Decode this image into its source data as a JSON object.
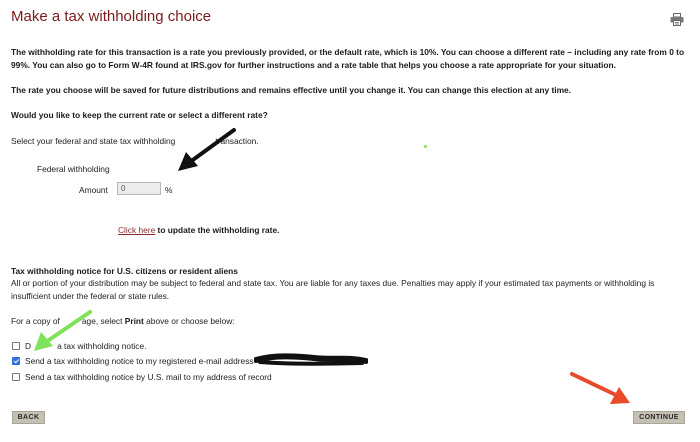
{
  "page": {
    "title": "Make a tax withholding choice",
    "icons": {
      "print": "printer-icon"
    }
  },
  "intro": {
    "p1": "The withholding rate for this transaction is a rate you previously provided, or the default rate, which is 10%. You can choose a different rate – including any rate from 0 to 99%. You can also go to Form W-4R found at IRS.gov for further instructions and a rate table that helps you choose a rate appropriate for your situation.",
    "p2": "The rate you choose will be saved for future distributions and remains effective until you change it. You can change this election at any time.",
    "question": "Would you like to keep the current rate or select a different rate?",
    "select_text": "Select your federal and state tax withholding",
    "select_text_tail": "transaction."
  },
  "federal": {
    "heading": "Federal withholding",
    "amount_label": "Amount",
    "amount_value": "0",
    "unit": "%",
    "click_link": "Click here",
    "click_tail": " to update the withholding rate."
  },
  "notice": {
    "heading": "Tax withholding notice for U.S. citizens or resident aliens",
    "body": "All or portion of your distribution may be subject to federal and state tax. You are liable for any taxes due. Penalties may apply if your estimated tax payments or withholding is insufficient under the federal or state rules.",
    "copy_pre": "For a copy of",
    "copy_mid": "age, select",
    "copy_print": "Print",
    "copy_post": "above or choose below:",
    "options": [
      {
        "label_a": "D",
        "label_b": "a tax withholding notice.",
        "checked": false
      },
      {
        "label": "Send a tax withholding notice to my registered e-mail address",
        "checked": true
      },
      {
        "label": "Send a tax withholding notice by U.S. mail to my address of record",
        "checked": false
      }
    ]
  },
  "buttons": {
    "back": "BACK",
    "continue": "CONTINUE"
  },
  "colors": {
    "title": "#7a1c1c",
    "link": "#8a2a2a",
    "button": "#c4c0b4",
    "arrow_black": "#111111",
    "arrow_green": "#7ee25a",
    "arrow_red": "#e84a2a"
  }
}
